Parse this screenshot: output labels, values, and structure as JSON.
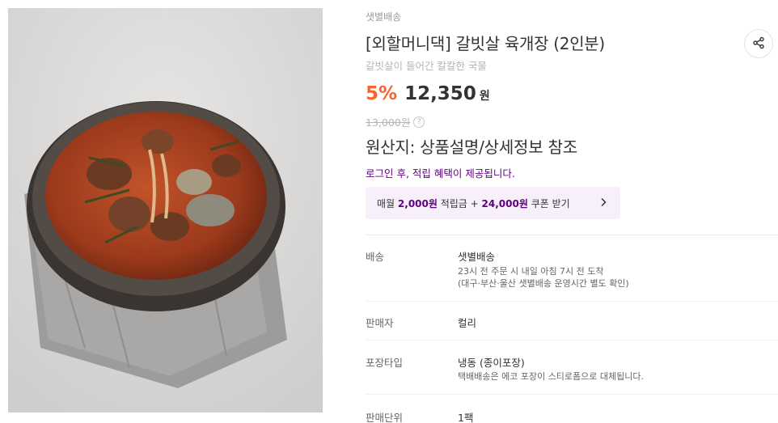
{
  "product": {
    "delivery_tag": "샛별배송",
    "title": "[외할머니댁] 갈빗살 육개장 (2인분)",
    "subtitle": "갈빗살이 들어간 칼칼한 국물",
    "discount_rate": "5%",
    "price": "12,350",
    "currency": "원",
    "original_price": "13,000원",
    "help_glyph": "?",
    "origin": "원산지: 상품설명/상세정보 참조",
    "login_benefit": "로그인 후, 적립 혜택이 제공됩니다."
  },
  "coupon": {
    "prefix": "매월 ",
    "points": "2,000원",
    "middle": " 적립금 + ",
    "coupon_amount": "24,000원",
    "suffix": " 쿠폰 받기"
  },
  "details": [
    {
      "label": "배송",
      "value": "샛별배송",
      "sub": [
        "23시 전 주문 시 내일 아침 7시 전 도착",
        "(대구·부산·울산 샛별배송 운영시간 별도 확인)"
      ]
    },
    {
      "label": "판매자",
      "value": "컬리",
      "sub": []
    },
    {
      "label": "포장타입",
      "value": "냉동 (종이포장)",
      "sub": [
        "택배배송은 에코 포장이 스티로폼으로 대체됩니다."
      ]
    },
    {
      "label": "판매단위",
      "value": "1팩",
      "sub": []
    }
  ],
  "icons": {
    "share": "share-icon",
    "chevron": "chevron-right-icon",
    "help": "question-circle-icon"
  },
  "colors": {
    "brand_purple": "#5f0080",
    "discount_orange": "#fa622f",
    "coupon_bg": "#f7f0fa"
  }
}
